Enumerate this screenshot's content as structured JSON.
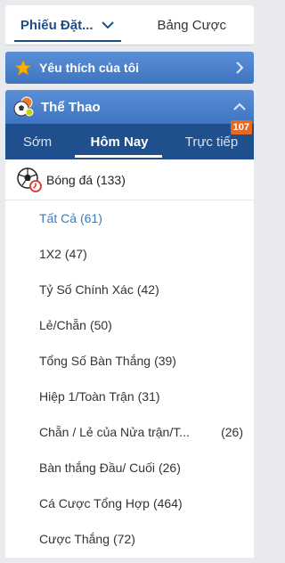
{
  "top_tabs": {
    "bet_slip": "Phiếu Đặt...",
    "bet_table": "Bảng Cược"
  },
  "favorites": {
    "label": "Yêu thích của tôi"
  },
  "sports": {
    "title": "Thể Thao",
    "time_tabs": {
      "early": "Sớm",
      "today": "Hôm Nay",
      "live": "Trực tiếp",
      "live_count": "107"
    },
    "sport": {
      "name": "Bóng đá",
      "count": "(133)"
    },
    "markets": [
      {
        "name": "Tất Cả",
        "count": "(61)"
      },
      {
        "name": "1X2",
        "count": "(47)"
      },
      {
        "name": "Tỷ Số Chính Xác",
        "count": "(42)"
      },
      {
        "name": "Lẻ/Chẵn",
        "count": "(50)"
      },
      {
        "name": "Tổng Số Bàn Thắng",
        "count": "(39)"
      },
      {
        "name": "Hiệp 1/Toàn Trận",
        "count": "(31)"
      },
      {
        "name": "Chẵn / Lẻ của Nửa trận/T...",
        "count": "(26)"
      },
      {
        "name": "Bàn thắng Đầu/ Cuối",
        "count": "(26)"
      },
      {
        "name": "Cá Cược Tổng Hợp",
        "count": "(464)"
      },
      {
        "name": "Cược Thắng",
        "count": "(72)"
      }
    ]
  },
  "colors": {
    "header_blue": "#3f74c2",
    "tab_bar": "#1f4f8c",
    "active_market": "#3b7bbf",
    "badge": "#e8681f"
  }
}
